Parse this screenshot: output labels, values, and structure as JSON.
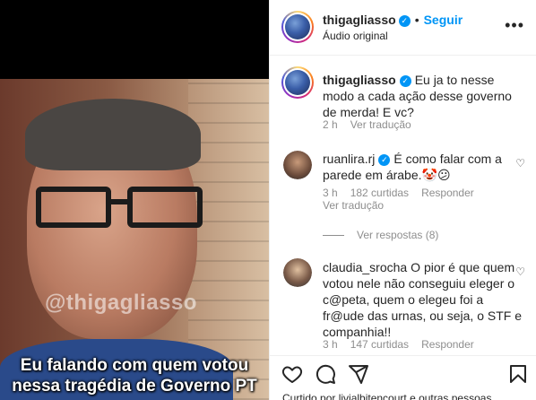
{
  "post": {
    "username": "thigagliasso",
    "follow_label": "Seguir",
    "audio_label": "Áudio original",
    "more_label": "•••"
  },
  "video": {
    "watermark": "@thigagliasso",
    "caption_line1": "Eu falando com quem votou",
    "caption_line2": "nessa tragédia de Governo PT"
  },
  "caption": {
    "username": "thigagliasso",
    "text": "Eu ja to nesse modo a cada ação desse governo de merda! E vc?",
    "time": "2 h",
    "translate_label": "Ver tradução"
  },
  "comments": [
    {
      "username": "ruanlira.rj",
      "text": "É como falar com a parede em árabe.🤡😕",
      "time": "3 h",
      "likes": "182 curtidas",
      "reply_label": "Responder",
      "translate_label": "Ver tradução",
      "view_replies": "Ver respostas (8)"
    },
    {
      "username": "claudia_srocha",
      "text": "O pior é que quem votou nele não conseguiu eleger o c@peta, quem o elegeu foi a fr@ude das urnas, ou seja, o STF e companhia!!",
      "time": "3 h",
      "likes": "147 curtidas",
      "reply_label": "Responder"
    }
  ],
  "footer": {
    "liked_by": "Curtido por livialbitencourt e outras pessoas"
  },
  "colors": {
    "accent": "#0095f6",
    "text": "#262626",
    "muted": "#8e8e8e"
  },
  "icons": [
    "verified-icon",
    "more-icon",
    "heart-icon",
    "comment-icon",
    "share-icon",
    "bookmark-icon"
  ]
}
